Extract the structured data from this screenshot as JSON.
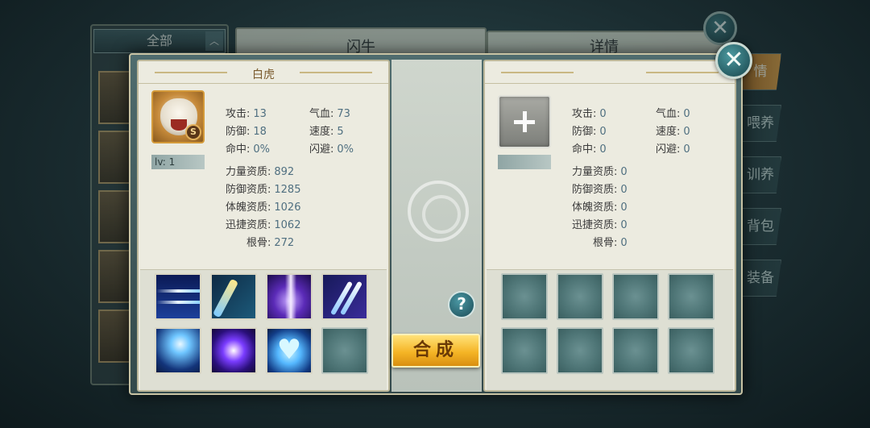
{
  "background": {
    "filter_label": "全部",
    "pet_name": "闪牛",
    "detail_tab": "详情",
    "side_tabs": [
      "情",
      "喂养",
      "训养",
      "背包",
      "装备"
    ]
  },
  "left_pet": {
    "name": "白虎",
    "rank_badge": "S",
    "level": "lv: 1",
    "stats": [
      {
        "label": "攻击:",
        "value": "13"
      },
      {
        "label": "气血:",
        "value": "73"
      },
      {
        "label": "防御:",
        "value": "18"
      },
      {
        "label": "速度:",
        "value": "5"
      },
      {
        "label": "命中:",
        "value": "0%"
      },
      {
        "label": "闪避:",
        "value": "0%"
      }
    ],
    "aptitudes": [
      {
        "label": "力量资质:",
        "value": "892"
      },
      {
        "label": "防御资质:",
        "value": "1285"
      },
      {
        "label": "体魄资质:",
        "value": "1026"
      },
      {
        "label": "迅捷资质:",
        "value": "1062"
      },
      {
        "label": "根骨:",
        "value": "272"
      }
    ],
    "skills": [
      "light-streak-icon",
      "dash-strike-icon",
      "purple-pillar-icon",
      "claw-slash-icon",
      "lightning-icon",
      "purple-orb-icon",
      "blue-heart-icon",
      "empty"
    ]
  },
  "right_pet": {
    "stats": [
      {
        "label": "攻击:",
        "value": "0"
      },
      {
        "label": "气血:",
        "value": "0"
      },
      {
        "label": "防御:",
        "value": "0"
      },
      {
        "label": "速度:",
        "value": "0"
      },
      {
        "label": "命中:",
        "value": "0"
      },
      {
        "label": "闪避:",
        "value": "0"
      }
    ],
    "aptitudes": [
      {
        "label": "力量资质:",
        "value": "0"
      },
      {
        "label": "防御资质:",
        "value": "0"
      },
      {
        "label": "体魄资质:",
        "value": "0"
      },
      {
        "label": "迅捷资质:",
        "value": "0"
      },
      {
        "label": "根骨:",
        "value": "0"
      }
    ]
  },
  "actions": {
    "compose_label": "合成",
    "help_label": "?",
    "close_label": "✕"
  }
}
